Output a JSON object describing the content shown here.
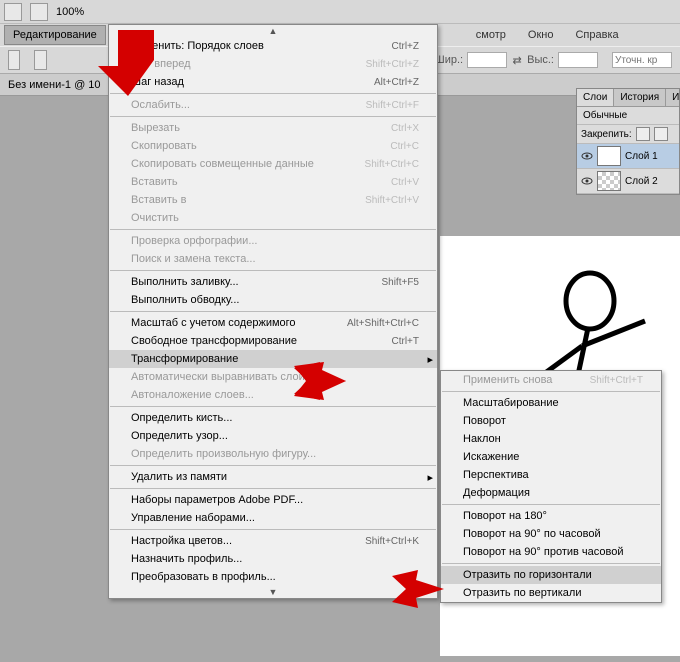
{
  "top": {
    "zoom": "100%"
  },
  "menubar": {
    "edit": "Редактирование",
    "view": "смотр",
    "window": "Окно",
    "help": "Справка"
  },
  "options": {
    "width_label": "Шир.:",
    "height_label": "Выс.:",
    "placeholder": "Уточн. кр"
  },
  "doc_tab": "Без имени-1 @ 10",
  "layers": {
    "tab_layers": "Слои",
    "tab_history": "История",
    "tab_i": "И",
    "mode": "Обычные",
    "lock_label": "Закрепить:",
    "layer1": "Слой 1",
    "layer2": "Слой 2"
  },
  "edit_menu": [
    {
      "label": "Отменить: Порядок слоев",
      "shortcut": "Ctrl+Z",
      "type": "item"
    },
    {
      "label": "Шаг вперед",
      "shortcut": "Shift+Ctrl+Z",
      "type": "item",
      "disabled": true
    },
    {
      "label": "Шаг назад",
      "shortcut": "Alt+Ctrl+Z",
      "type": "item"
    },
    {
      "type": "sep"
    },
    {
      "label": "Ослабить...",
      "shortcut": "Shift+Ctrl+F",
      "type": "item",
      "disabled": true
    },
    {
      "type": "sep"
    },
    {
      "label": "Вырезать",
      "shortcut": "Ctrl+X",
      "type": "item",
      "disabled": true
    },
    {
      "label": "Скопировать",
      "shortcut": "Ctrl+C",
      "type": "item",
      "disabled": true
    },
    {
      "label": "Скопировать совмещенные данные",
      "shortcut": "Shift+Ctrl+C",
      "type": "item",
      "disabled": true
    },
    {
      "label": "Вставить",
      "shortcut": "Ctrl+V",
      "type": "item",
      "disabled": true
    },
    {
      "label": "Вставить в",
      "shortcut": "Shift+Ctrl+V",
      "type": "item",
      "disabled": true
    },
    {
      "label": "Очистить",
      "shortcut": "",
      "type": "item",
      "disabled": true
    },
    {
      "type": "sep"
    },
    {
      "label": "Проверка орфографии...",
      "shortcut": "",
      "type": "item",
      "disabled": true
    },
    {
      "label": "Поиск и замена текста...",
      "shortcut": "",
      "type": "item",
      "disabled": true
    },
    {
      "type": "sep"
    },
    {
      "label": "Выполнить заливку...",
      "shortcut": "Shift+F5",
      "type": "item"
    },
    {
      "label": "Выполнить обводку...",
      "shortcut": "",
      "type": "item"
    },
    {
      "type": "sep"
    },
    {
      "label": "Масштаб с учетом содержимого",
      "shortcut": "Alt+Shift+Ctrl+C",
      "type": "item"
    },
    {
      "label": "Свободное трансформирование",
      "shortcut": "Ctrl+T",
      "type": "item"
    },
    {
      "label": "Трансформирование",
      "shortcut": "",
      "type": "item",
      "submenu": true,
      "highlighted": true
    },
    {
      "label": "Автоматически выравнивать слои...",
      "shortcut": "",
      "type": "item",
      "disabled": true
    },
    {
      "label": "Автоналожение слоев...",
      "shortcut": "",
      "type": "item",
      "disabled": true
    },
    {
      "type": "sep"
    },
    {
      "label": "Определить кисть...",
      "shortcut": "",
      "type": "item"
    },
    {
      "label": "Определить узор...",
      "shortcut": "",
      "type": "item"
    },
    {
      "label": "Определить произвольную фигуру...",
      "shortcut": "",
      "type": "item",
      "disabled": true
    },
    {
      "type": "sep"
    },
    {
      "label": "Удалить из памяти",
      "shortcut": "",
      "type": "item",
      "submenu": true
    },
    {
      "type": "sep"
    },
    {
      "label": "Наборы параметров Adobe PDF...",
      "shortcut": "",
      "type": "item"
    },
    {
      "label": "Управление наборами...",
      "shortcut": "",
      "type": "item"
    },
    {
      "type": "sep"
    },
    {
      "label": "Настройка цветов...",
      "shortcut": "Shift+Ctrl+K",
      "type": "item"
    },
    {
      "label": "Назначить профиль...",
      "shortcut": "",
      "type": "item"
    },
    {
      "label": "Преобразовать в профиль...",
      "shortcut": "",
      "type": "item"
    }
  ],
  "transform_menu": [
    {
      "label": "Применить снова",
      "shortcut": "Shift+Ctrl+T",
      "type": "item",
      "disabled": true
    },
    {
      "type": "sep"
    },
    {
      "label": "Масштабирование",
      "type": "item"
    },
    {
      "label": "Поворот",
      "type": "item"
    },
    {
      "label": "Наклон",
      "type": "item"
    },
    {
      "label": "Искажение",
      "type": "item"
    },
    {
      "label": "Перспектива",
      "type": "item"
    },
    {
      "label": "Деформация",
      "type": "item"
    },
    {
      "type": "sep"
    },
    {
      "label": "Поворот на 180°",
      "type": "item"
    },
    {
      "label": "Поворот на 90° по часовой",
      "type": "item"
    },
    {
      "label": "Поворот на 90° против часовой",
      "type": "item"
    },
    {
      "type": "sep"
    },
    {
      "label": "Отразить по горизонтали",
      "type": "item",
      "highlighted": true
    },
    {
      "label": "Отразить по вертикали",
      "type": "item"
    }
  ]
}
